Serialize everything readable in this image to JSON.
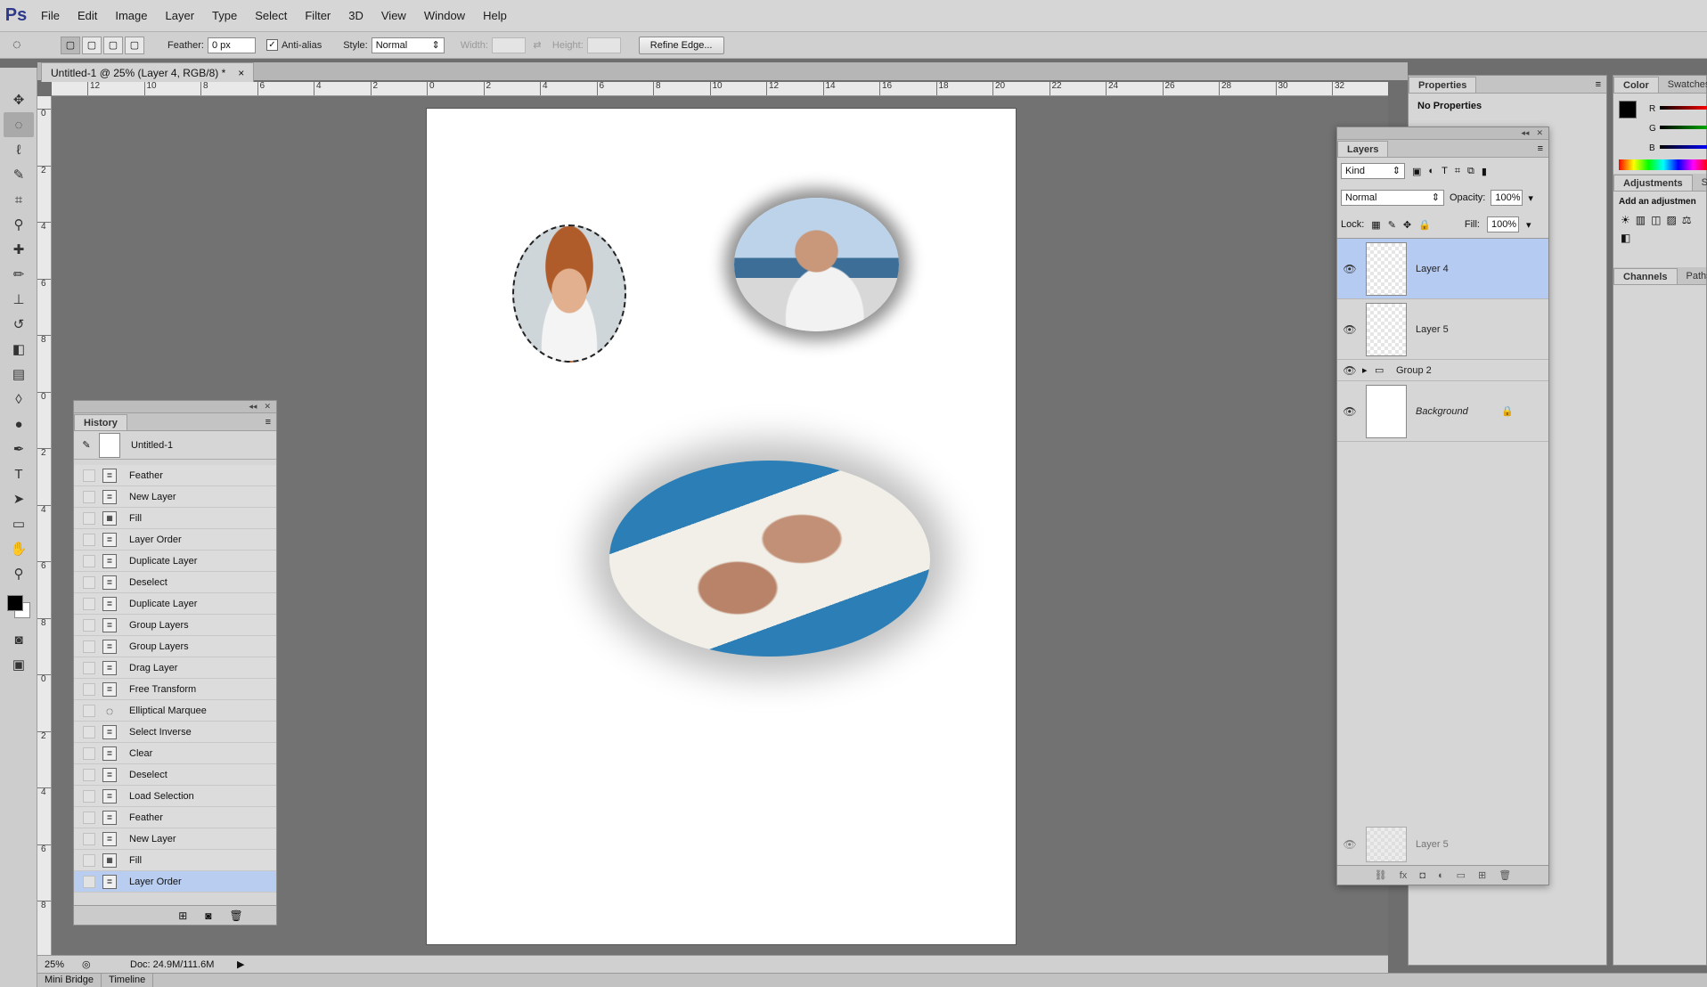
{
  "app": {
    "logo": "Ps"
  },
  "menu": [
    "File",
    "Edit",
    "Image",
    "Layer",
    "Type",
    "Select",
    "Filter",
    "3D",
    "View",
    "Window",
    "Help"
  ],
  "options": {
    "feather_label": "Feather:",
    "feather_value": "0 px",
    "antialias_label": "Anti-alias",
    "style_label": "Style:",
    "style_value": "Normal",
    "width_label": "Width:",
    "height_label": "Height:",
    "refine_edge": "Refine Edge..."
  },
  "document": {
    "tab_title": "Untitled-1 @ 25% (Layer 4, RGB/8) *",
    "close": "×",
    "ruler_h": [
      "12",
      "10",
      "8",
      "6",
      "4",
      "2",
      "0",
      "2",
      "4",
      "6",
      "8",
      "10",
      "12",
      "14",
      "16",
      "18",
      "20",
      "22",
      "24",
      "26",
      "28",
      "30",
      "32"
    ],
    "ruler_v": [
      "0",
      "2",
      "4",
      "6",
      "8",
      "0",
      "2",
      "4",
      "6",
      "8",
      "0",
      "2",
      "4",
      "6",
      "8"
    ]
  },
  "status": {
    "zoom": "25%",
    "doc_size": "Doc: 24.9M/111.6M"
  },
  "bottom_tabs": [
    "Mini Bridge",
    "Timeline"
  ],
  "history": {
    "title": "History",
    "snapshot": "Untitled-1",
    "items": [
      "Feather",
      "New Layer",
      "Fill",
      "Layer Order",
      "Duplicate Layer",
      "Deselect",
      "Duplicate Layer",
      "Group Layers",
      "Group Layers",
      "Drag Layer",
      "Free Transform",
      "Elliptical Marquee",
      "Select Inverse",
      "Clear",
      "Deselect",
      "Load Selection",
      "Feather",
      "New Layer",
      "Fill",
      "Layer Order"
    ],
    "selected_index": 19
  },
  "properties": {
    "title": "Properties",
    "empty": "No Properties"
  },
  "layers": {
    "title": "Layers",
    "filter": "Kind",
    "blend_mode": "Normal",
    "opacity_label": "Opacity:",
    "opacity_value": "100%",
    "lock_label": "Lock:",
    "fill_label": "Fill:",
    "fill_value": "100%",
    "items": [
      {
        "name": "Layer 4",
        "selected": true
      },
      {
        "name": "Layer 5",
        "selected": false
      },
      {
        "name": "Group 2",
        "selected": false
      },
      {
        "name": "Background",
        "selected": false
      }
    ],
    "dragging": "Layer 5"
  },
  "color_panel": {
    "tabs": [
      "Color",
      "Swatches"
    ],
    "channels": [
      "R",
      "G",
      "B"
    ],
    "adjustments_tabs": [
      "Adjustments",
      "Styl"
    ],
    "adjustments_hint": "Add an adjustmen",
    "channels_tabs": [
      "Channels",
      "Paths"
    ]
  }
}
